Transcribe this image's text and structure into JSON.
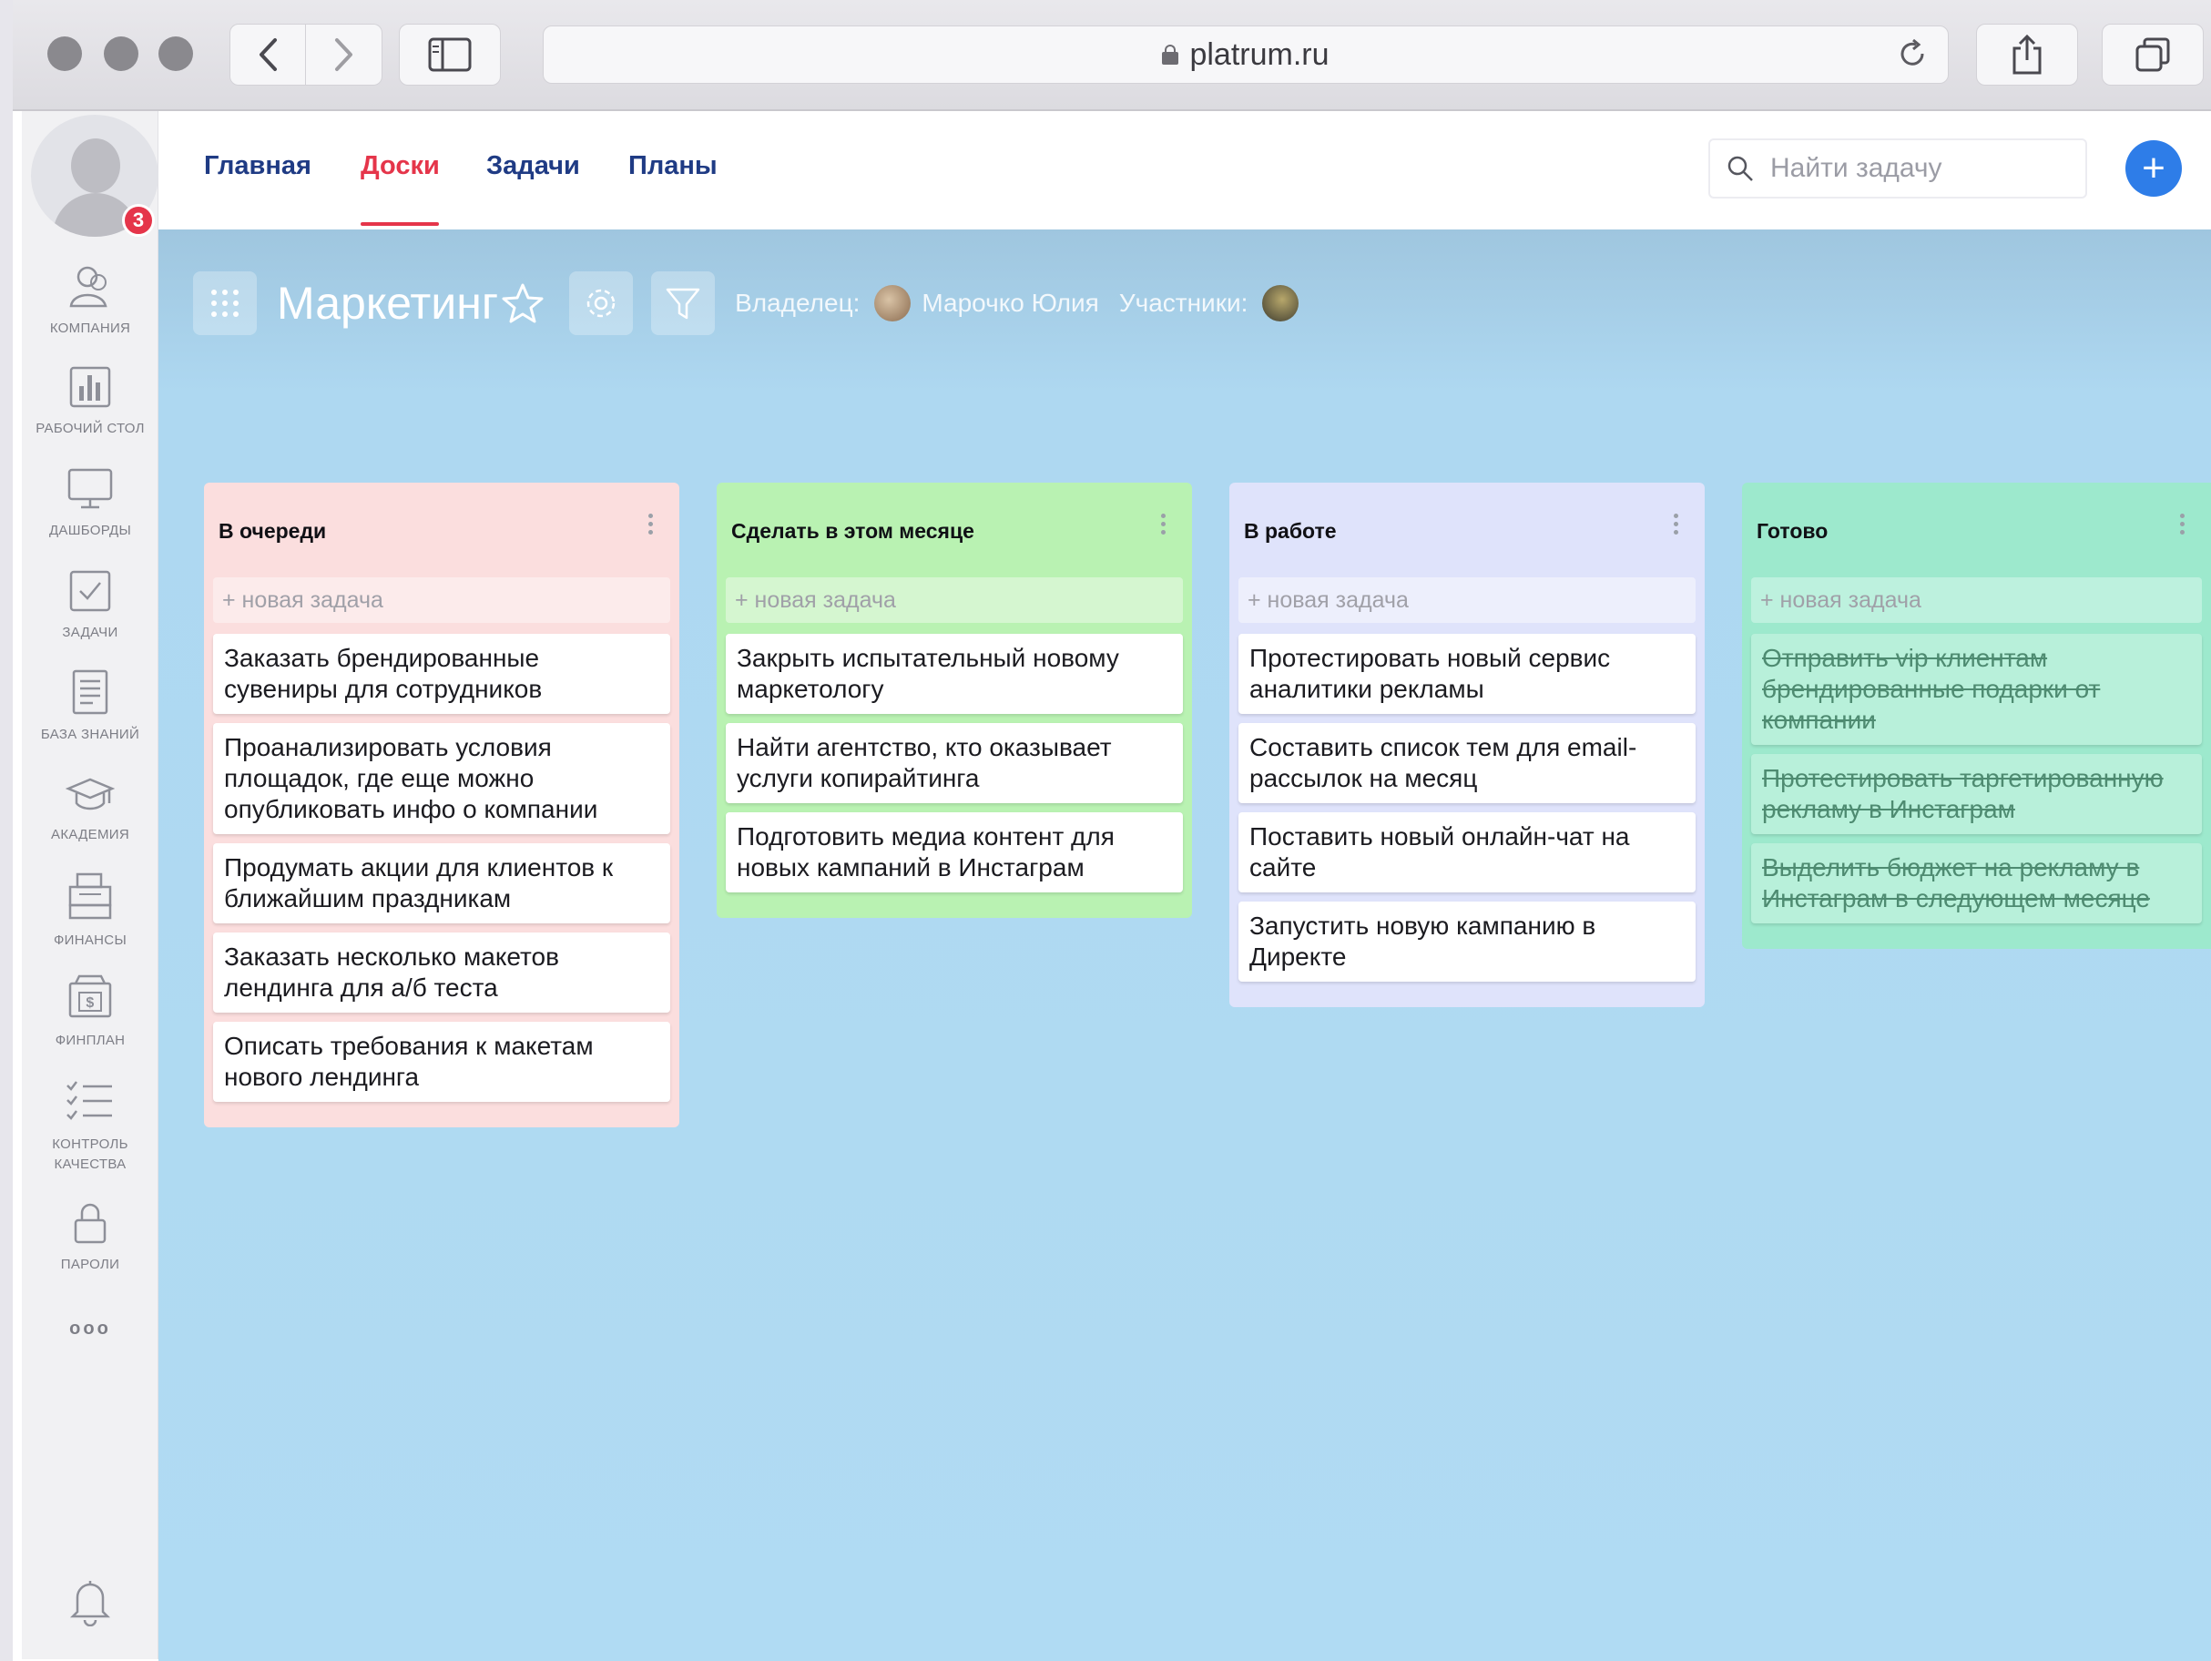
{
  "browser": {
    "url": "platrum.ru"
  },
  "sidebar": {
    "notification_count": "3",
    "items": [
      {
        "label": "КОМПАНИЯ",
        "icon": "company-icon"
      },
      {
        "label": "РАБОЧИЙ СТОЛ",
        "icon": "bar-chart-icon"
      },
      {
        "label": "ДАШБОРДЫ",
        "icon": "monitor-icon"
      },
      {
        "label": "ЗАДАЧИ",
        "icon": "checkbox-icon"
      },
      {
        "label": "БАЗА ЗНАНИЙ",
        "icon": "document-icon"
      },
      {
        "label": "АКАДЕМИЯ",
        "icon": "graduation-cap-icon"
      },
      {
        "label": "ФИНАНСЫ",
        "icon": "cash-register-icon"
      },
      {
        "label": "ФИНПЛАН",
        "icon": "wallet-icon"
      },
      {
        "label": "КОНТРОЛЬ",
        "label2": "КАЧЕСТВА",
        "icon": "checklist-icon"
      },
      {
        "label": "ПАРОЛИ",
        "icon": "lock-icon"
      }
    ],
    "more": "ooo"
  },
  "topnav": {
    "tabs": [
      {
        "label": "Главная",
        "active": false
      },
      {
        "label": "Доски",
        "active": true
      },
      {
        "label": "Задачи",
        "active": false
      },
      {
        "label": "Планы",
        "active": false
      }
    ],
    "search_placeholder": "Найти задачу",
    "add_label": "+"
  },
  "board": {
    "title": "Маркетинг",
    "owner_label": "Владелец:",
    "owner_name": "Марочко Юлия",
    "members_label": "Участники:",
    "columns": [
      {
        "title": "В очереди",
        "new_task": "+ новая задача",
        "cards": [
          "Заказать брендированные сувениры для сотрудников",
          "Проанализировать условия площадок, где еще можно опубликовать инфо о компании",
          "Продумать акции для клиентов к ближайшим праздникам",
          "Заказать несколько макетов лендинга для а/б теста",
          "Описать требования к макетам нового лендинга"
        ]
      },
      {
        "title": "Сделать в этом месяце",
        "new_task": "+ новая задача",
        "cards": [
          "Закрыть испытательный новому маркетологу",
          "Найти агентство, кто оказывает услуги копирайтинга",
          "Подготовить медиа контент для новых кампаний в Инстаграм"
        ]
      },
      {
        "title": "В работе",
        "new_task": "+ новая задача",
        "cards": [
          "Протестировать новый сервис аналитики рекламы",
          "Составить список тем для email-рассылок на месяц",
          "Поставить новый онлайн-чат на сайте",
          "Запустить новую кампанию в Директе"
        ]
      },
      {
        "title": "Готово",
        "new_task": "+ новая задача",
        "cards": [
          "Отправить vip клиентам брендированные подарки от компании",
          "Протестировать таргетированную рекламу в Инстаграм",
          "Выделить бюджет на рекламу в Инстаграм в следующем месяце"
        ]
      }
    ]
  }
}
